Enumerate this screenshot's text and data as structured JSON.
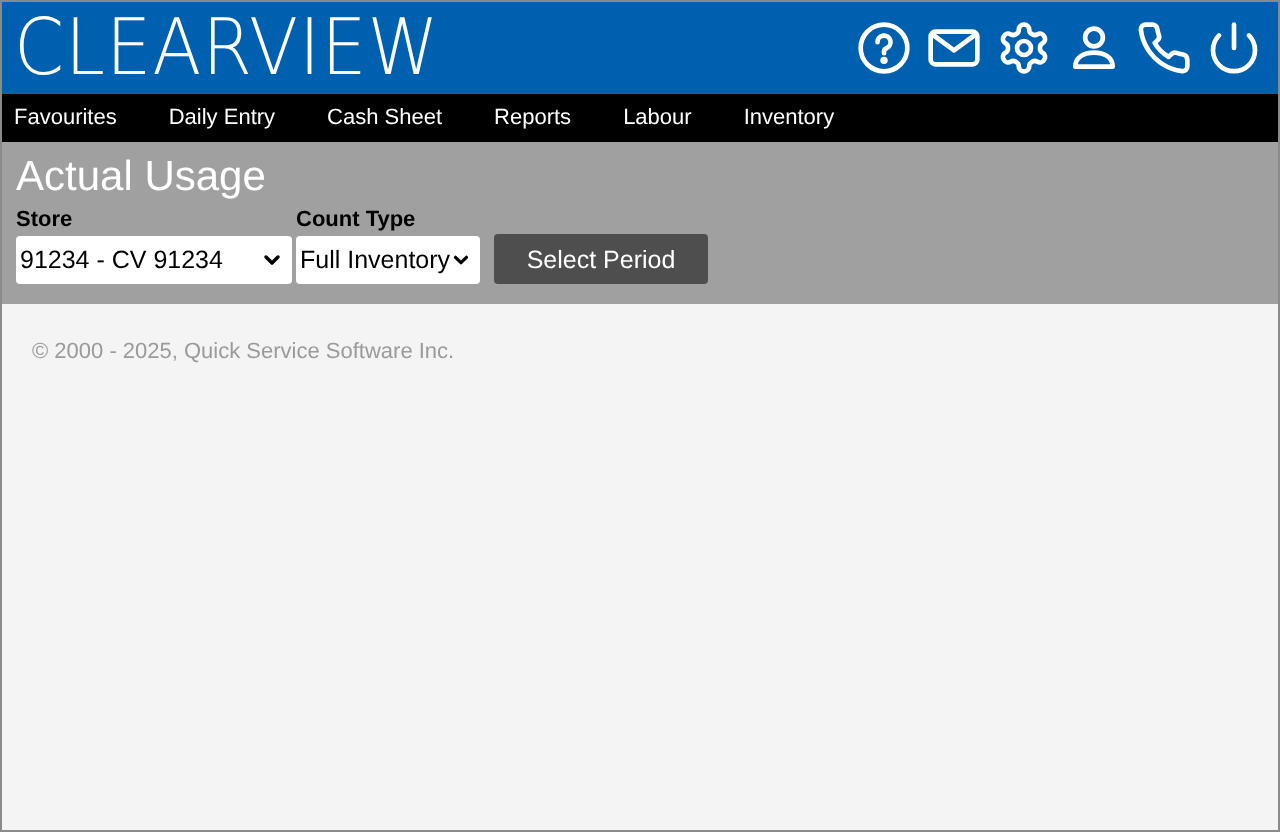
{
  "header": {
    "logo": "CLEARVIEW"
  },
  "nav": [
    {
      "label": "Favourites"
    },
    {
      "label": "Daily Entry"
    },
    {
      "label": "Cash Sheet"
    },
    {
      "label": "Reports"
    },
    {
      "label": "Labour"
    },
    {
      "label": "Inventory"
    }
  ],
  "page": {
    "title": "Actual Usage"
  },
  "filters": [
    {
      "label": "Store",
      "value": "91234 - CV 91234",
      "kind": "wide"
    },
    {
      "label": "Count Type",
      "value": "Full Inventory",
      "kind": "narrow"
    }
  ],
  "actions": {
    "button": "Select Period"
  },
  "footer": {
    "copyright": "© 2000 - 2025, Quick Service Software Inc."
  }
}
